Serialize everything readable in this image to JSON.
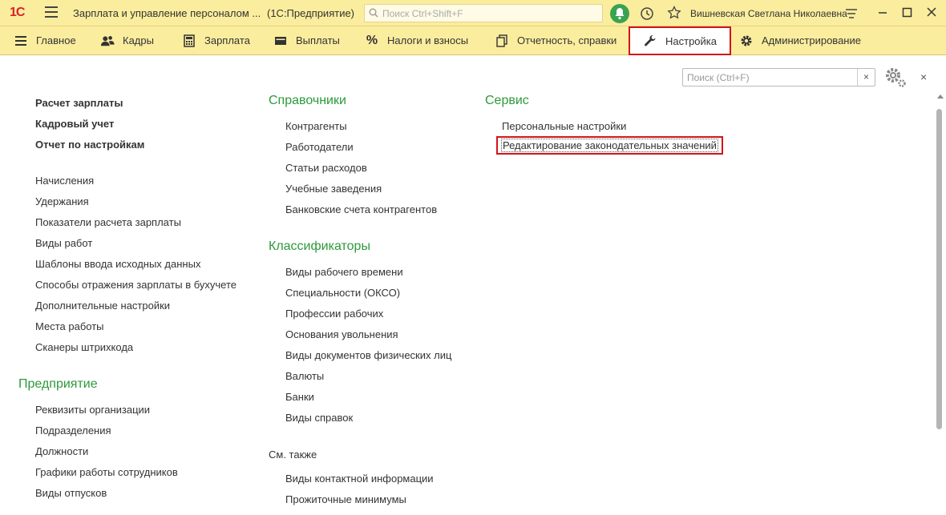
{
  "titlebar": {
    "logo": "1С",
    "title": "Зарплата и управление персоналом ...",
    "subtitle": "(1С:Предприятие)",
    "search_placeholder": "Поиск Ctrl+Shift+F",
    "user": "Вишневская Светлана Николаевна"
  },
  "sections": [
    {
      "label": "Главное",
      "icon": "hamburger-icon"
    },
    {
      "label": "Кадры",
      "icon": "people-icon"
    },
    {
      "label": "Зарплата",
      "icon": "calculator-icon"
    },
    {
      "label": "Выплаты",
      "icon": "wallet-icon"
    },
    {
      "label": "Налоги и взносы",
      "icon": "percent-icon"
    },
    {
      "label": "Отчетность, справки",
      "icon": "documents-icon"
    },
    {
      "label": "Настройка",
      "icon": "wrench-icon",
      "active": true
    },
    {
      "label": "Администрирование",
      "icon": "gear-icon"
    }
  ],
  "panel": {
    "search_placeholder": "Поиск (Ctrl+F)",
    "clear": "×",
    "close": "×"
  },
  "col1": {
    "top_items": [
      "Расчет зарплаты",
      "Кадровый учет",
      "Отчет по настройкам"
    ],
    "items": [
      "Начисления",
      "Удержания",
      "Показатели расчета зарплаты",
      "Виды работ",
      "Шаблоны ввода исходных данных",
      "Способы отражения зарплаты в бухучете",
      "Дополнительные настройки",
      "Места работы",
      "Сканеры штрихкода"
    ],
    "group2_title": "Предприятие",
    "group2_items": [
      "Реквизиты организации",
      "Подразделения",
      "Должности",
      "Графики работы сотрудников",
      "Виды отпусков"
    ]
  },
  "col2": {
    "group1_title": "Справочники",
    "group1_items": [
      "Контрагенты",
      "Работодатели",
      "Статьи расходов",
      "Учебные заведения",
      "Банковские счета контрагентов"
    ],
    "group2_title": "Классификаторы",
    "group2_items": [
      "Виды рабочего времени",
      "Специальности (ОКСО)",
      "Профессии рабочих",
      "Основания увольнения",
      "Виды документов физических лиц",
      "Валюты",
      "Банки",
      "Виды справок"
    ],
    "see_also_title": "См. также",
    "see_also_items": [
      "Виды контактной информации",
      "Прожиточные минимумы"
    ]
  },
  "col3": {
    "group_title": "Сервис",
    "items": [
      "Персональные настройки",
      "Редактирование законодательных значений"
    ]
  },
  "colors": {
    "bar": "#fbed9e",
    "accent_green": "#2c9a3a",
    "highlight_red": "#d3151a"
  }
}
